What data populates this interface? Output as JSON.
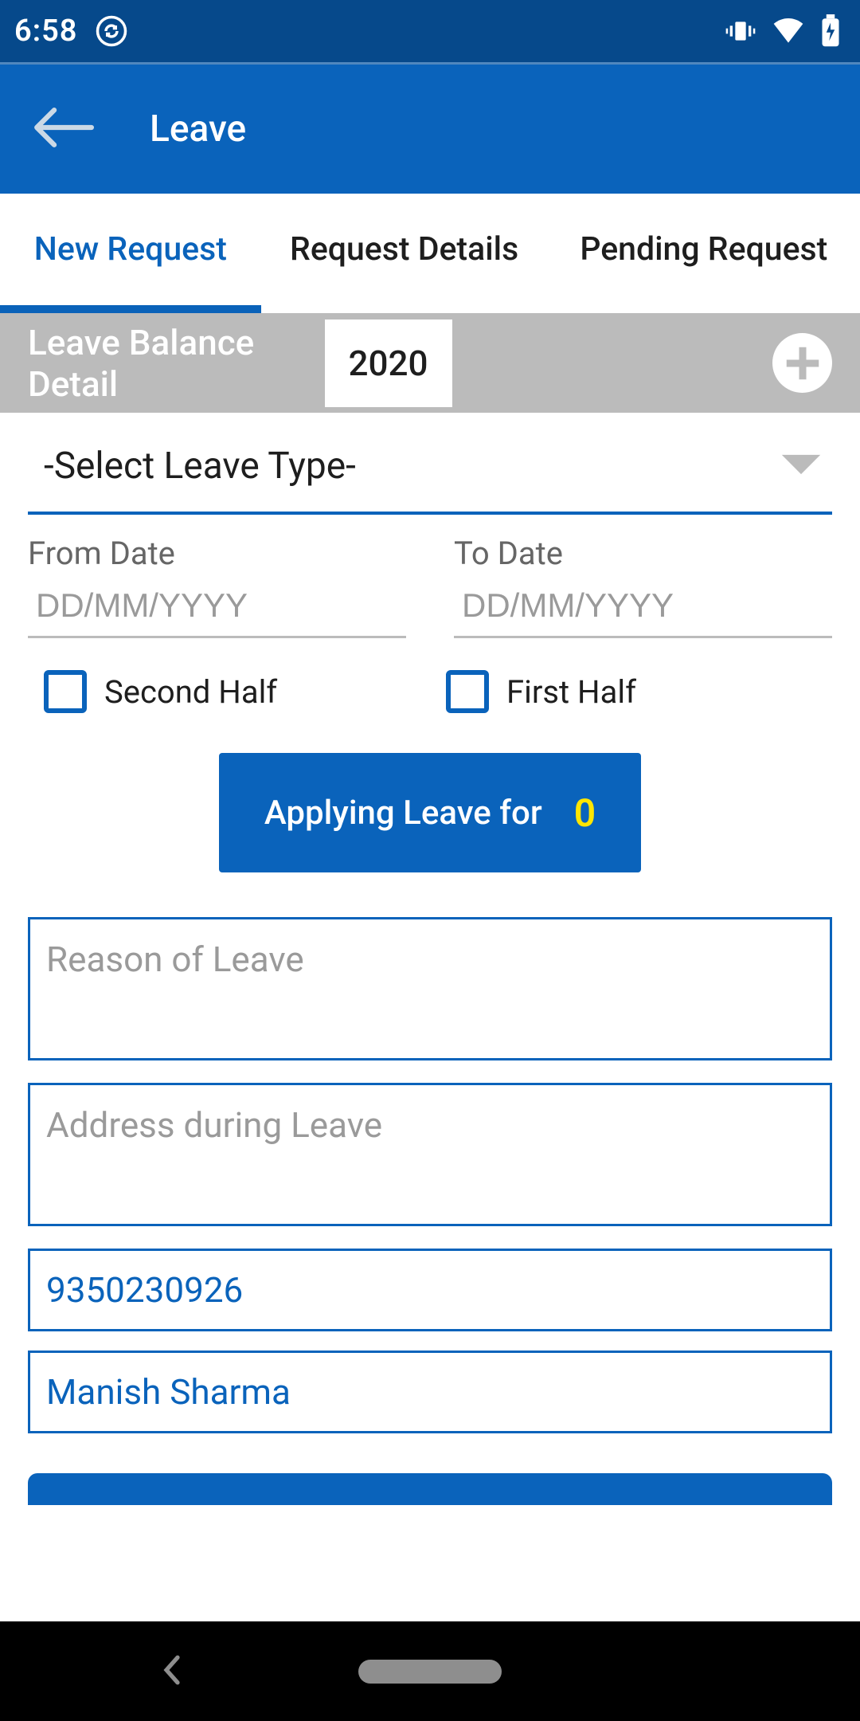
{
  "status": {
    "time": "6:58"
  },
  "header": {
    "title": "Leave"
  },
  "tabs": [
    {
      "label": "New Request",
      "active": true
    },
    {
      "label": "Request Details",
      "active": false
    },
    {
      "label": "Pending Request",
      "active": false
    }
  ],
  "balance": {
    "label": "Leave Balance Detail",
    "year": "2020"
  },
  "form": {
    "leave_type_placeholder": "-Select Leave Type-",
    "from_label": "From Date",
    "to_label": "To Date",
    "date_placeholder": "DD/MM/YYYY",
    "second_half_label": "Second Half",
    "first_half_label": "First Half",
    "applying_label": "Applying Leave for",
    "applying_count": "0",
    "reason_placeholder": "Reason of Leave",
    "address_placeholder": "Address during Leave",
    "phone_value": "9350230926",
    "name_value": "Manish Sharma"
  }
}
